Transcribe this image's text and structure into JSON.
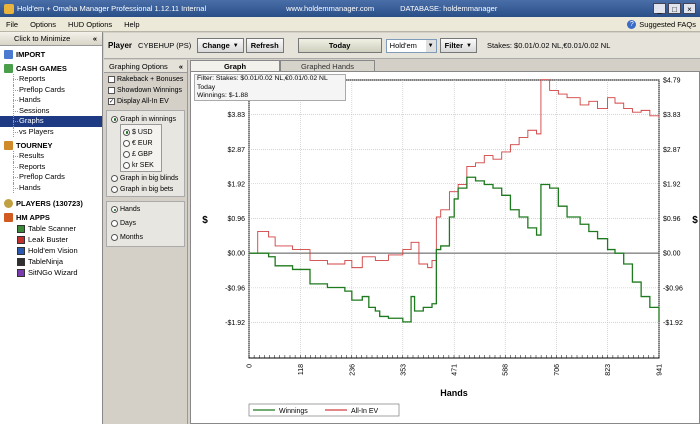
{
  "window": {
    "title": "Hold'em + Omaha Manager Professional 1.12.11 Internal",
    "website": "www.holdemmanager.com",
    "database": "DATABASE: holdemmanager",
    "minimize_icon": "minimize-icon",
    "maximize_icon": "maximize-icon",
    "close_icon": "close-icon"
  },
  "menu": {
    "items": [
      "File",
      "Options",
      "HUD Options",
      "Help"
    ],
    "suggested": "Suggested FAQs"
  },
  "sidebar": {
    "minimize_label": "Click to Minimize",
    "minimize_chevron": "«",
    "import_label": "IMPORT",
    "cash_games_label": "CASH GAMES",
    "cash_items": [
      "Reports",
      "Preflop Cards",
      "Hands",
      "Sessions",
      "Graphs",
      "vs Players"
    ],
    "tourney_label": "TOURNEY",
    "tourney_items": [
      "Results",
      "Reports",
      "Preflop Cards",
      "Hands"
    ],
    "players_label": "PLAYERS (130723)",
    "hm_apps_label": "HM APPS",
    "apps": [
      "Table Scanner",
      "Leak Buster",
      "Hold'em Vision",
      "TableNinja",
      "SitNGo Wizard"
    ]
  },
  "toolbar": {
    "player_label": "Player",
    "player_name": "CYBEHUP (PS)",
    "change_label": "Change",
    "refresh_label": "Refresh",
    "today_label": "Today",
    "game_value": "Hold'em",
    "filter_label": "Filter",
    "stakes": "Stakes: $0.01/0.02 NL,€0.01/0.02 NL"
  },
  "options": {
    "header": "Graphing Options",
    "header_chevron": "«",
    "rakeback": "Rakeback + Bonuses",
    "showdown": "Showdown Winnings",
    "allin_ev": "Display All-In EV",
    "allin_checked": "✓",
    "graph_winnings": "Graph in winnings",
    "currencies": [
      "$ USD",
      "€ EUR",
      "£ GBP",
      "kr SEK"
    ],
    "graph_bb": "Graph in big blinds",
    "graph_bets": "Graph in big bets",
    "time_options": [
      "Hands",
      "Days",
      "Months"
    ]
  },
  "tabs": {
    "graph": "Graph",
    "graphed_hands": "Graphed Hands"
  },
  "filter_info": {
    "line1": "Filter: Stakes: $0.01/0.02 NL,€0.01/0.02 NL",
    "line2": "Today",
    "line3": "Winnings: $-1.88"
  },
  "chart_data": {
    "type": "line",
    "title": "",
    "xlabel": "Hands",
    "ylabel": "$",
    "x_ticks": [
      "0",
      "118",
      "236",
      "353",
      "471",
      "588",
      "706",
      "823",
      "941"
    ],
    "y_ticks": [
      "$4.79",
      "$3.83",
      "$2.87",
      "$1.92",
      "$0.96",
      "$0.00",
      "-$0.96",
      "-$1.92"
    ],
    "xlim": [
      0,
      941
    ],
    "ylim": [
      -2.9,
      4.79
    ],
    "legend_position": "bottom-left",
    "grid": true,
    "series": [
      {
        "name": "Winnings",
        "color": "#1e7a1e",
        "x": [
          0,
          20,
          45,
          60,
          100,
          140,
          180,
          220,
          236,
          260,
          275,
          290,
          300,
          320,
          353,
          372,
          380,
          400,
          420,
          430,
          440,
          460,
          471,
          480,
          500,
          520,
          540,
          560,
          580,
          600,
          620,
          640,
          660,
          670,
          690,
          710,
          730,
          760,
          780,
          800,
          823,
          840,
          860,
          880,
          900,
          920,
          941
        ],
        "values": [
          0,
          0,
          -0.1,
          -0.35,
          -0.45,
          -0.85,
          -0.95,
          -1.05,
          -1.3,
          -1.2,
          -1.5,
          -1.6,
          -1.75,
          -1.8,
          -1.9,
          -1.2,
          -1.6,
          -1.5,
          -1.4,
          0.1,
          0.2,
          1.0,
          1.5,
          1.8,
          2.1,
          2.0,
          1.9,
          1.8,
          1.6,
          1.2,
          1.0,
          0.7,
          0.5,
          1.9,
          1.8,
          1.3,
          1.0,
          0.8,
          0.6,
          0.4,
          0.1,
          0,
          -0.3,
          -0.8,
          -1.2,
          -1.5,
          -1.88
        ]
      },
      {
        "name": "All-In EV",
        "color": "#d04040",
        "x": [
          0,
          20,
          45,
          60,
          100,
          140,
          180,
          220,
          236,
          260,
          290,
          320,
          353,
          372,
          390,
          410,
          420,
          430,
          440,
          460,
          480,
          500,
          520,
          540,
          560,
          580,
          600,
          620,
          640,
          660,
          670,
          690,
          710,
          730,
          760,
          780,
          800,
          823,
          840,
          860,
          880,
          900,
          920,
          941
        ],
        "values": [
          0,
          0.6,
          0.45,
          0.2,
          0.1,
          -0.2,
          -0.3,
          -0.2,
          -0.4,
          -0.1,
          -0.2,
          -0.05,
          0.1,
          0.3,
          -0.3,
          -0.4,
          -0.2,
          1.0,
          1.2,
          1.7,
          1.9,
          2.4,
          2.5,
          2.7,
          2.6,
          2.8,
          3.0,
          3.2,
          3.4,
          3.3,
          4.8,
          4.5,
          4.4,
          4.3,
          4.1,
          4.2,
          4.0,
          4.3,
          4.15,
          4.0,
          3.9,
          3.95,
          3.8,
          3.75
        ]
      }
    ]
  }
}
